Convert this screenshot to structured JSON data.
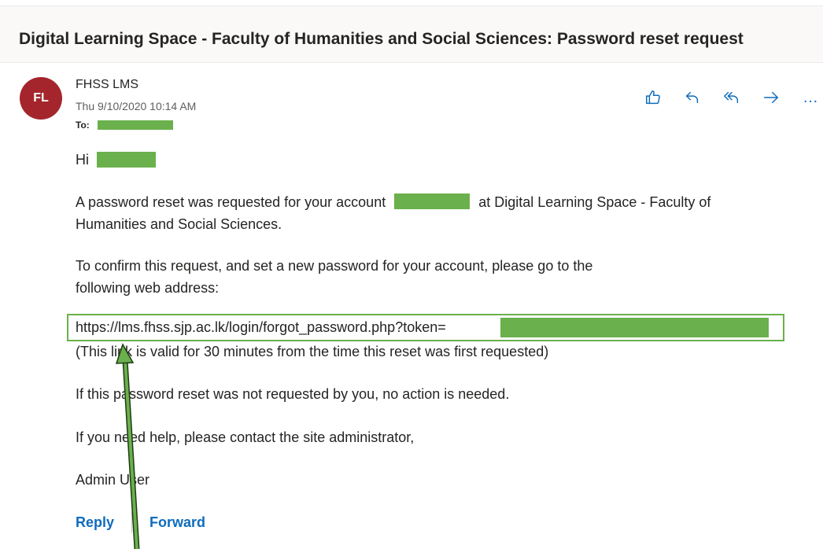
{
  "email": {
    "subject": "Digital Learning Space - Faculty of Humanities and Social Sciences: Password reset request",
    "sender_initials": "FL",
    "sender_name": "FHSS LMS",
    "date": "Thu 9/10/2020 10:14 AM",
    "to_label": "To:",
    "actions": [
      {
        "name": "like",
        "icon": "thumbs-up-icon"
      },
      {
        "name": "reply",
        "icon": "reply-icon"
      },
      {
        "name": "reply-all",
        "icon": "reply-all-icon"
      },
      {
        "name": "forward",
        "icon": "forward-icon"
      },
      {
        "name": "more",
        "icon": "more-icon",
        "label": "…"
      }
    ]
  },
  "body": {
    "greeting": "Hi",
    "paragraph1_start": "A password reset was requested for your account",
    "paragraph1_end": "at Digital Learning Space - Faculty of Humanities and Social Sciences.",
    "paragraph2": "To confirm this request, and set a new password for your account, please go to the following web address:",
    "reset_url": "https://lms.fhss.sjp.ac.lk/login/forgot_password.php?token=",
    "link_note": "(This link is valid for 30 minutes from the time this reset was first requested)",
    "paragraph3": "If this password reset was not requested by you, no action is needed.",
    "paragraph4": "If you need help, please contact the site administrator,",
    "signature": "Admin User"
  },
  "footer": {
    "reply_label": "Reply",
    "forward_label": "Forward"
  },
  "colors": {
    "avatar_bg": "#a4262c",
    "redaction": "#6ab04c",
    "highlight_border": "#6ab04c",
    "arrow": "#6ab04c",
    "link_blue": "#0f6cbd"
  }
}
